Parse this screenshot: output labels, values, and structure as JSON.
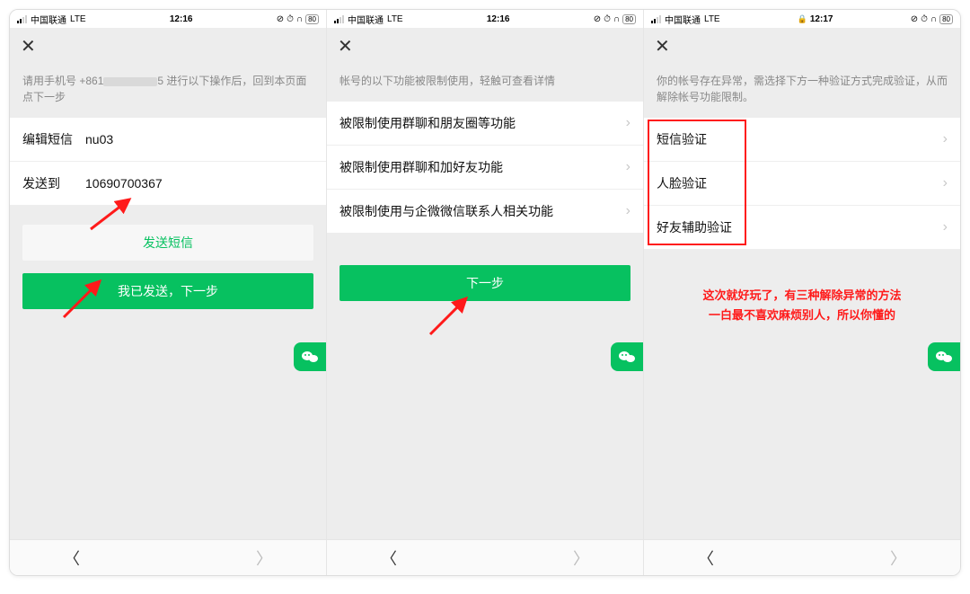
{
  "status": {
    "carrier": "中国联通",
    "net": "LTE",
    "time1": "12:16",
    "time2": "12:16",
    "time3": "12:17",
    "battery": "80"
  },
  "screen1": {
    "instruction_prefix": "请用手机号 +861",
    "instruction_mask": "　　　　　",
    "instruction_suffix": "5 进行以下操作后，回到本页面点下一步",
    "row1_label": "编辑短信",
    "row1_value": "nu03",
    "row2_label": "发送到",
    "row2_value": "10690700367",
    "btn_secondary": "发送短信",
    "btn_primary": "我已发送，下一步"
  },
  "screen2": {
    "instruction": "帐号的以下功能被限制使用，轻触可查看详情",
    "item1": "被限制使用群聊和朋友圈等功能",
    "item2": "被限制使用群聊和加好友功能",
    "item3": "被限制使用与企微微信联系人相关功能",
    "btn_primary": "下一步"
  },
  "screen3": {
    "instruction": "你的帐号存在异常，需选择下方一种验证方式完成验证，从而解除帐号功能限制。",
    "item1": "短信验证",
    "item2": "人脸验证",
    "item3": "好友辅助验证",
    "annotation_line1": "这次就好玩了，有三种解除异常的方法",
    "annotation_line2": "一白最不喜欢麻烦别人，所以你懂的"
  },
  "icons": {
    "chevron": "›",
    "close": "✕",
    "back": "〈",
    "fwd": "〉",
    "alarm": "⏰",
    "headphone": "🎧",
    "lock": "🔒"
  }
}
